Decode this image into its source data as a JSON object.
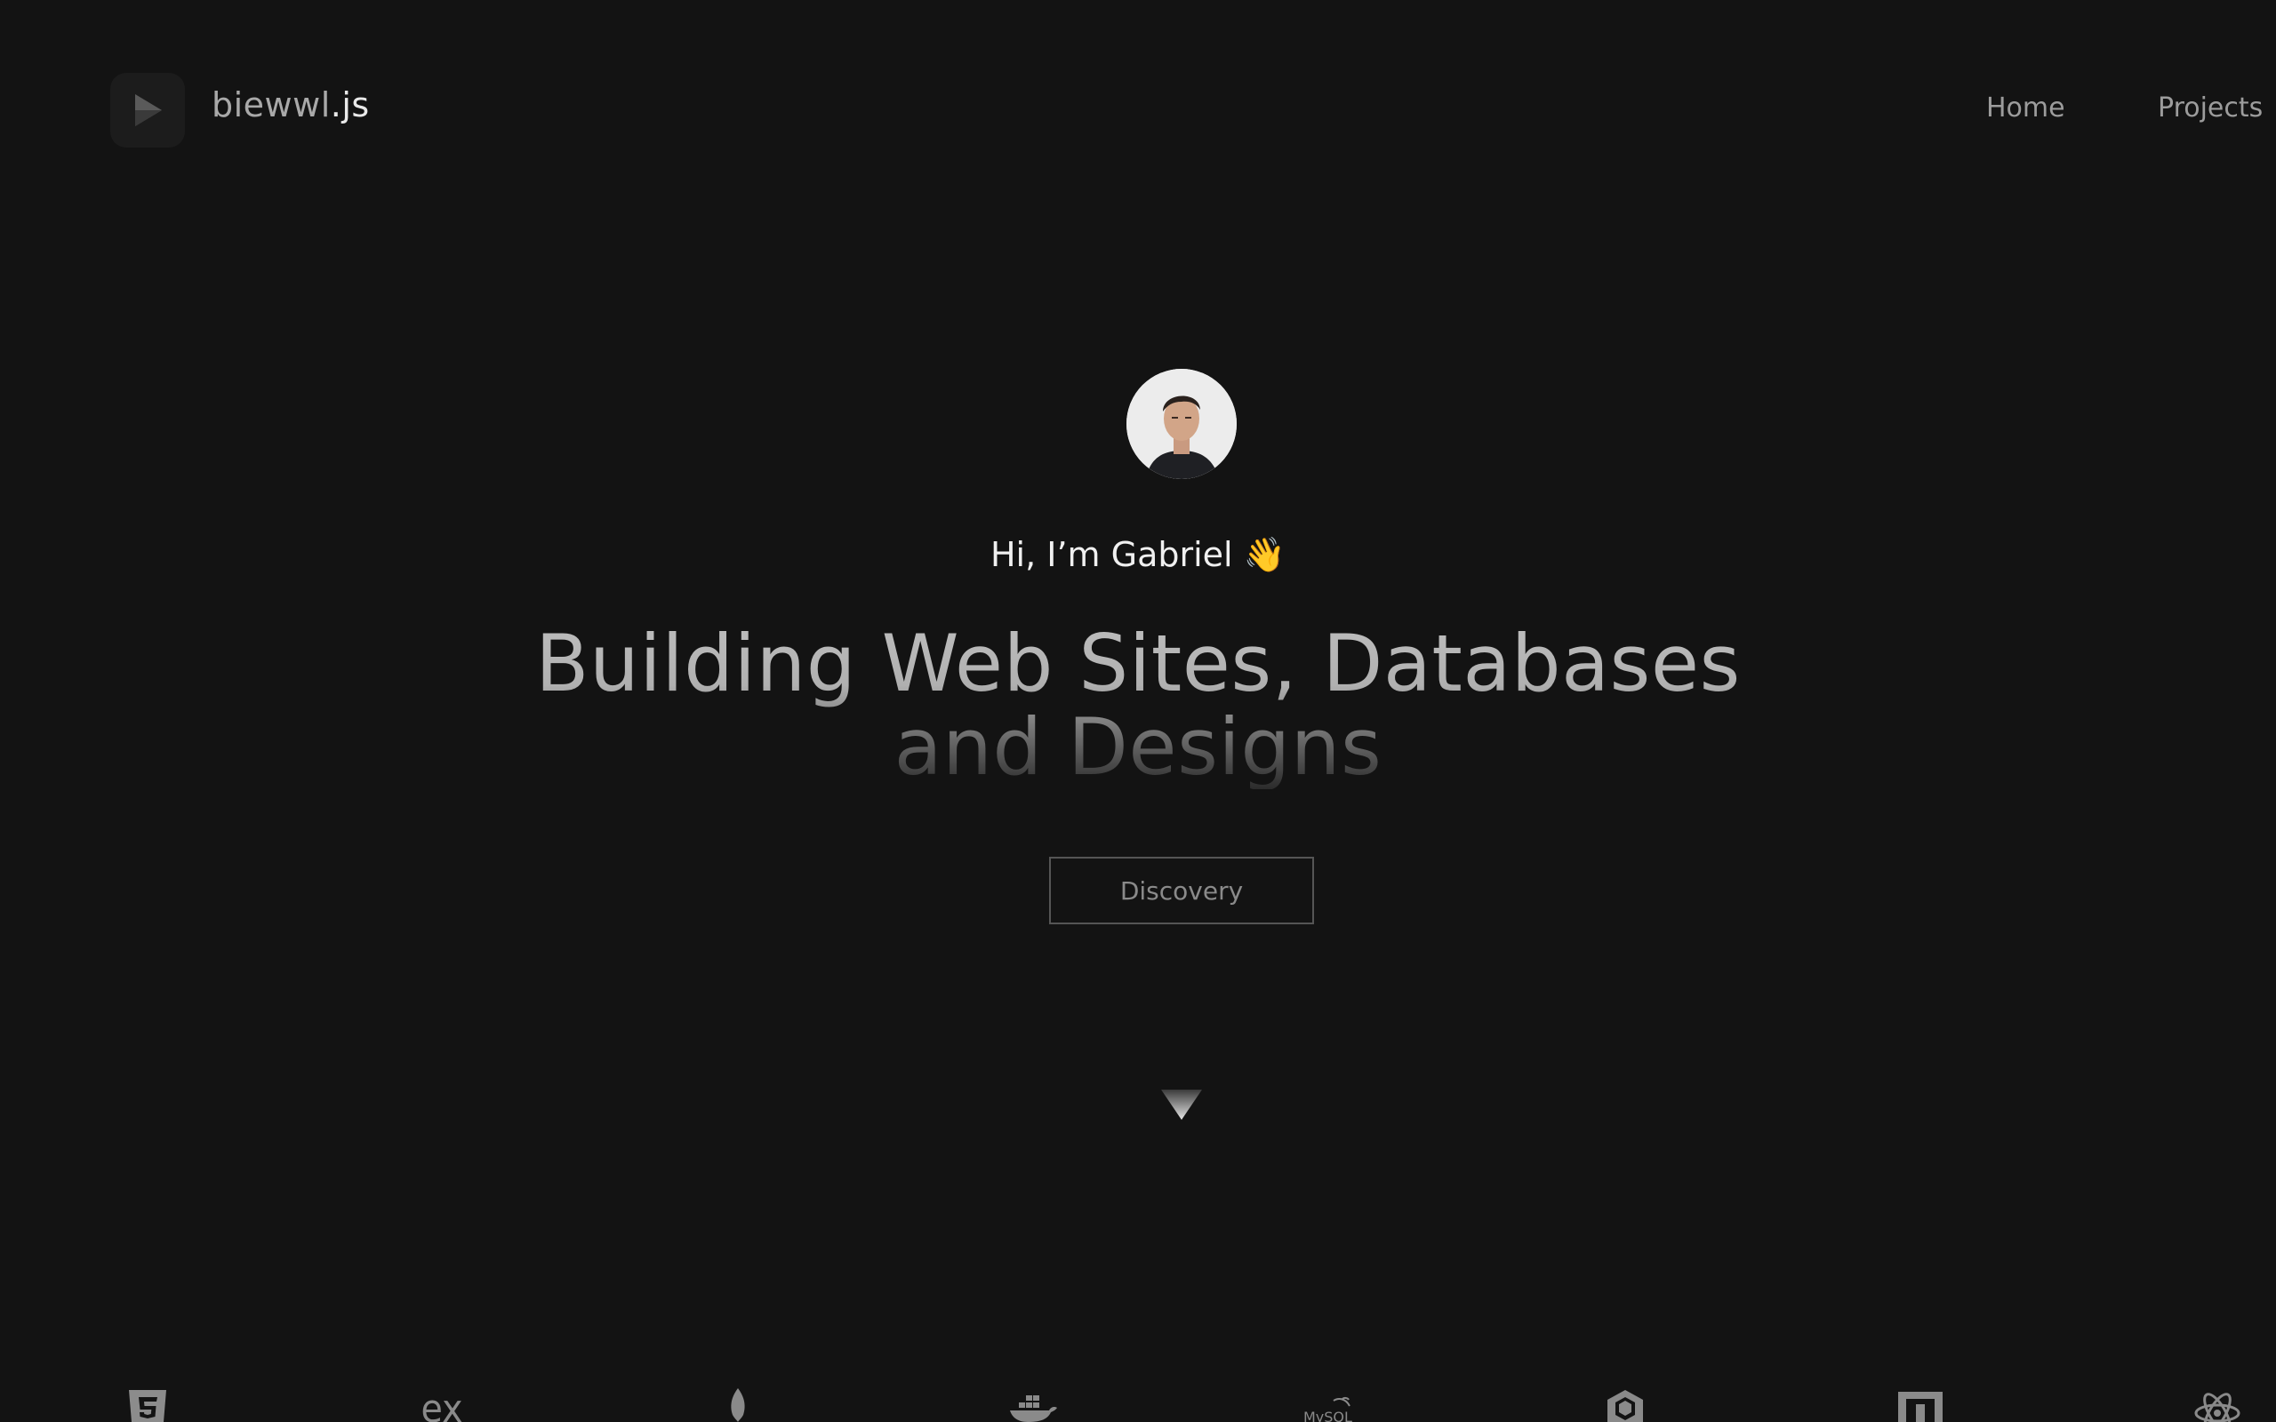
{
  "header": {
    "brand_name": "biewwl",
    "brand_ext": ".js",
    "logo_icon": "play-icon",
    "nav": [
      {
        "label": "Home"
      },
      {
        "label": "Projects"
      }
    ]
  },
  "hero": {
    "avatar": "profile-photo",
    "greeting": "Hi, I’m Gabriel",
    "greeting_emoji": "👋",
    "headline_line1": "Building Web Sites, Databases",
    "headline_line2": "and Designs",
    "cta_label": "Discovery",
    "scroll_icon": "triangle-down-icon"
  },
  "tech_stack": {
    "icons": [
      "html5-icon",
      "express-icon",
      "mongodb-icon",
      "docker-icon",
      "mysql-icon",
      "sequelize-icon",
      "npm-icon",
      "react-icon"
    ],
    "express_text": "ex",
    "mysql_text": "MySQL"
  },
  "colors": {
    "background": "#131313",
    "text_primary": "#f0f0f0",
    "text_muted": "#9c9c9c",
    "button_border": "#555555",
    "emoji": "#f4c332"
  }
}
